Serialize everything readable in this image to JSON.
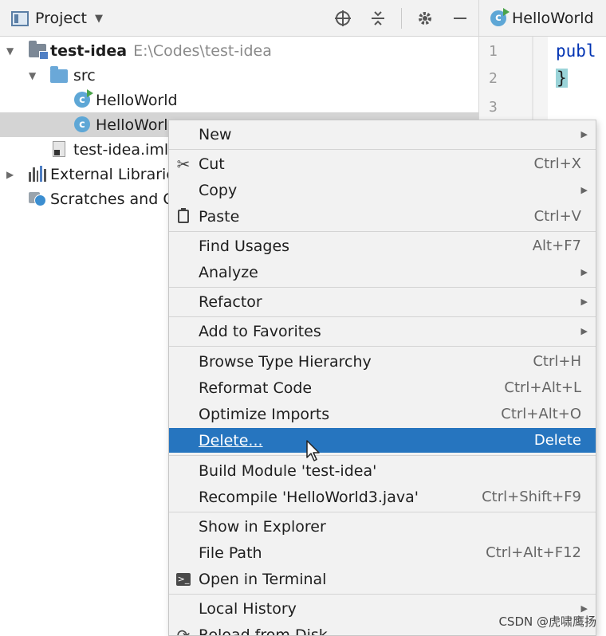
{
  "header": {
    "title": "Project",
    "tools": [
      "locate-icon",
      "collapse-icon",
      "gear-icon",
      "minimize-icon"
    ]
  },
  "editor": {
    "tab_title": "HelloWorld",
    "line_numbers": [
      "1",
      "2",
      "3"
    ],
    "code_lines": [
      "publ",
      "}"
    ]
  },
  "tree": {
    "rows": [
      {
        "label": "test-idea",
        "path": "E:\\Codes\\test-idea"
      },
      {
        "label": "src"
      },
      {
        "label": "HelloWorld"
      },
      {
        "label": "HelloWorl"
      },
      {
        "label": "test-idea.iml"
      },
      {
        "label": "External Librarie"
      },
      {
        "label": "Scratches and Co"
      }
    ]
  },
  "menu": {
    "items": [
      {
        "label": "New",
        "submenu": true
      },
      {
        "label": "Cut",
        "shortcut": "Ctrl+X",
        "icon": "scissors-icon"
      },
      {
        "label": "Copy",
        "submenu": true
      },
      {
        "label": "Paste",
        "shortcut": "Ctrl+V",
        "icon": "clipboard-icon"
      },
      {
        "label": "Find Usages",
        "shortcut": "Alt+F7"
      },
      {
        "label": "Analyze",
        "submenu": true
      },
      {
        "label": "Refactor",
        "submenu": true
      },
      {
        "label": "Add to Favorites",
        "submenu": true
      },
      {
        "label": "Browse Type Hierarchy",
        "shortcut": "Ctrl+H"
      },
      {
        "label": "Reformat Code",
        "shortcut": "Ctrl+Alt+L"
      },
      {
        "label": "Optimize Imports",
        "shortcut": "Ctrl+Alt+O"
      },
      {
        "label": "Delete...",
        "shortcut": "Delete",
        "highlighted": true
      },
      {
        "label": "Build Module 'test-idea'"
      },
      {
        "label": "Recompile 'HelloWorld3.java'",
        "shortcut": "Ctrl+Shift+F9"
      },
      {
        "label": "Show in Explorer"
      },
      {
        "label": "File Path",
        "shortcut": "Ctrl+Alt+F12"
      },
      {
        "label": "Open in Terminal",
        "icon": "terminal-icon"
      },
      {
        "label": "Local History",
        "submenu": true
      },
      {
        "label": "Reload from Disk",
        "icon": "reload-icon"
      }
    ]
  },
  "colors": {
    "highlight": "#2675bf",
    "selection": "#d4d4d4",
    "menu_bg": "#f2f2f2"
  },
  "watermark": "CSDN @虎啸鹰扬"
}
